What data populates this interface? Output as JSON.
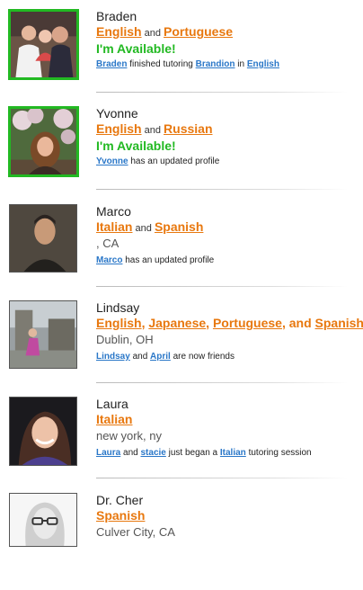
{
  "tutors": [
    {
      "name": "Braden",
      "languages": [
        {
          "label": "English",
          "after": " and "
        },
        {
          "label": "Portuguese",
          "after": ""
        }
      ],
      "availability": "I'm Available!",
      "location": "",
      "activity": [
        {
          "text": "Braden",
          "link": true
        },
        {
          "text": " finished tutoring ",
          "link": false
        },
        {
          "text": "Brandion",
          "link": true
        },
        {
          "text": " in ",
          "link": false
        },
        {
          "text": "English",
          "link": true
        }
      ]
    },
    {
      "name": "Yvonne",
      "languages": [
        {
          "label": "English",
          "after": " and "
        },
        {
          "label": "Russian",
          "after": ""
        }
      ],
      "availability": "I'm Available!",
      "location": "",
      "activity": [
        {
          "text": "Yvonne",
          "link": true
        },
        {
          "text": " has an updated profile",
          "link": false
        }
      ]
    },
    {
      "name": "Marco",
      "languages": [
        {
          "label": "Italian",
          "after": " and "
        },
        {
          "label": "Spanish",
          "after": ""
        }
      ],
      "availability": "",
      "location": ", CA",
      "activity": [
        {
          "text": "Marco",
          "link": true
        },
        {
          "text": " has an updated profile",
          "link": false
        }
      ]
    },
    {
      "name": "Lindsay",
      "languages": [
        {
          "label": "English",
          "after": ", "
        },
        {
          "label": "Japanese",
          "after": ", "
        },
        {
          "label": "Portuguese",
          "after": ", and "
        },
        {
          "label": "Spanish",
          "after": ""
        }
      ],
      "availability": "",
      "location": "Dublin, OH",
      "activity": [
        {
          "text": "Lindsay",
          "link": true
        },
        {
          "text": " and ",
          "link": false
        },
        {
          "text": "April",
          "link": true
        },
        {
          "text": " are now friends",
          "link": false
        }
      ]
    },
    {
      "name": "Laura",
      "languages": [
        {
          "label": "Italian",
          "after": ""
        }
      ],
      "availability": "",
      "location": "new york, ny",
      "activity": [
        {
          "text": "Laura",
          "link": true
        },
        {
          "text": " and ",
          "link": false
        },
        {
          "text": "stacie",
          "link": true
        },
        {
          "text": " just began a ",
          "link": false
        },
        {
          "text": "Italian",
          "link": true
        },
        {
          "text": " tutoring session",
          "link": false
        }
      ]
    },
    {
      "name": "Dr. Cher",
      "languages": [
        {
          "label": "Spanish",
          "after": ""
        }
      ],
      "availability": "",
      "location": "Culver City, CA",
      "activity": []
    }
  ],
  "colors": {
    "language_link": "#e8780f",
    "available": "#22b922",
    "activity_link": "#2a77c8"
  }
}
